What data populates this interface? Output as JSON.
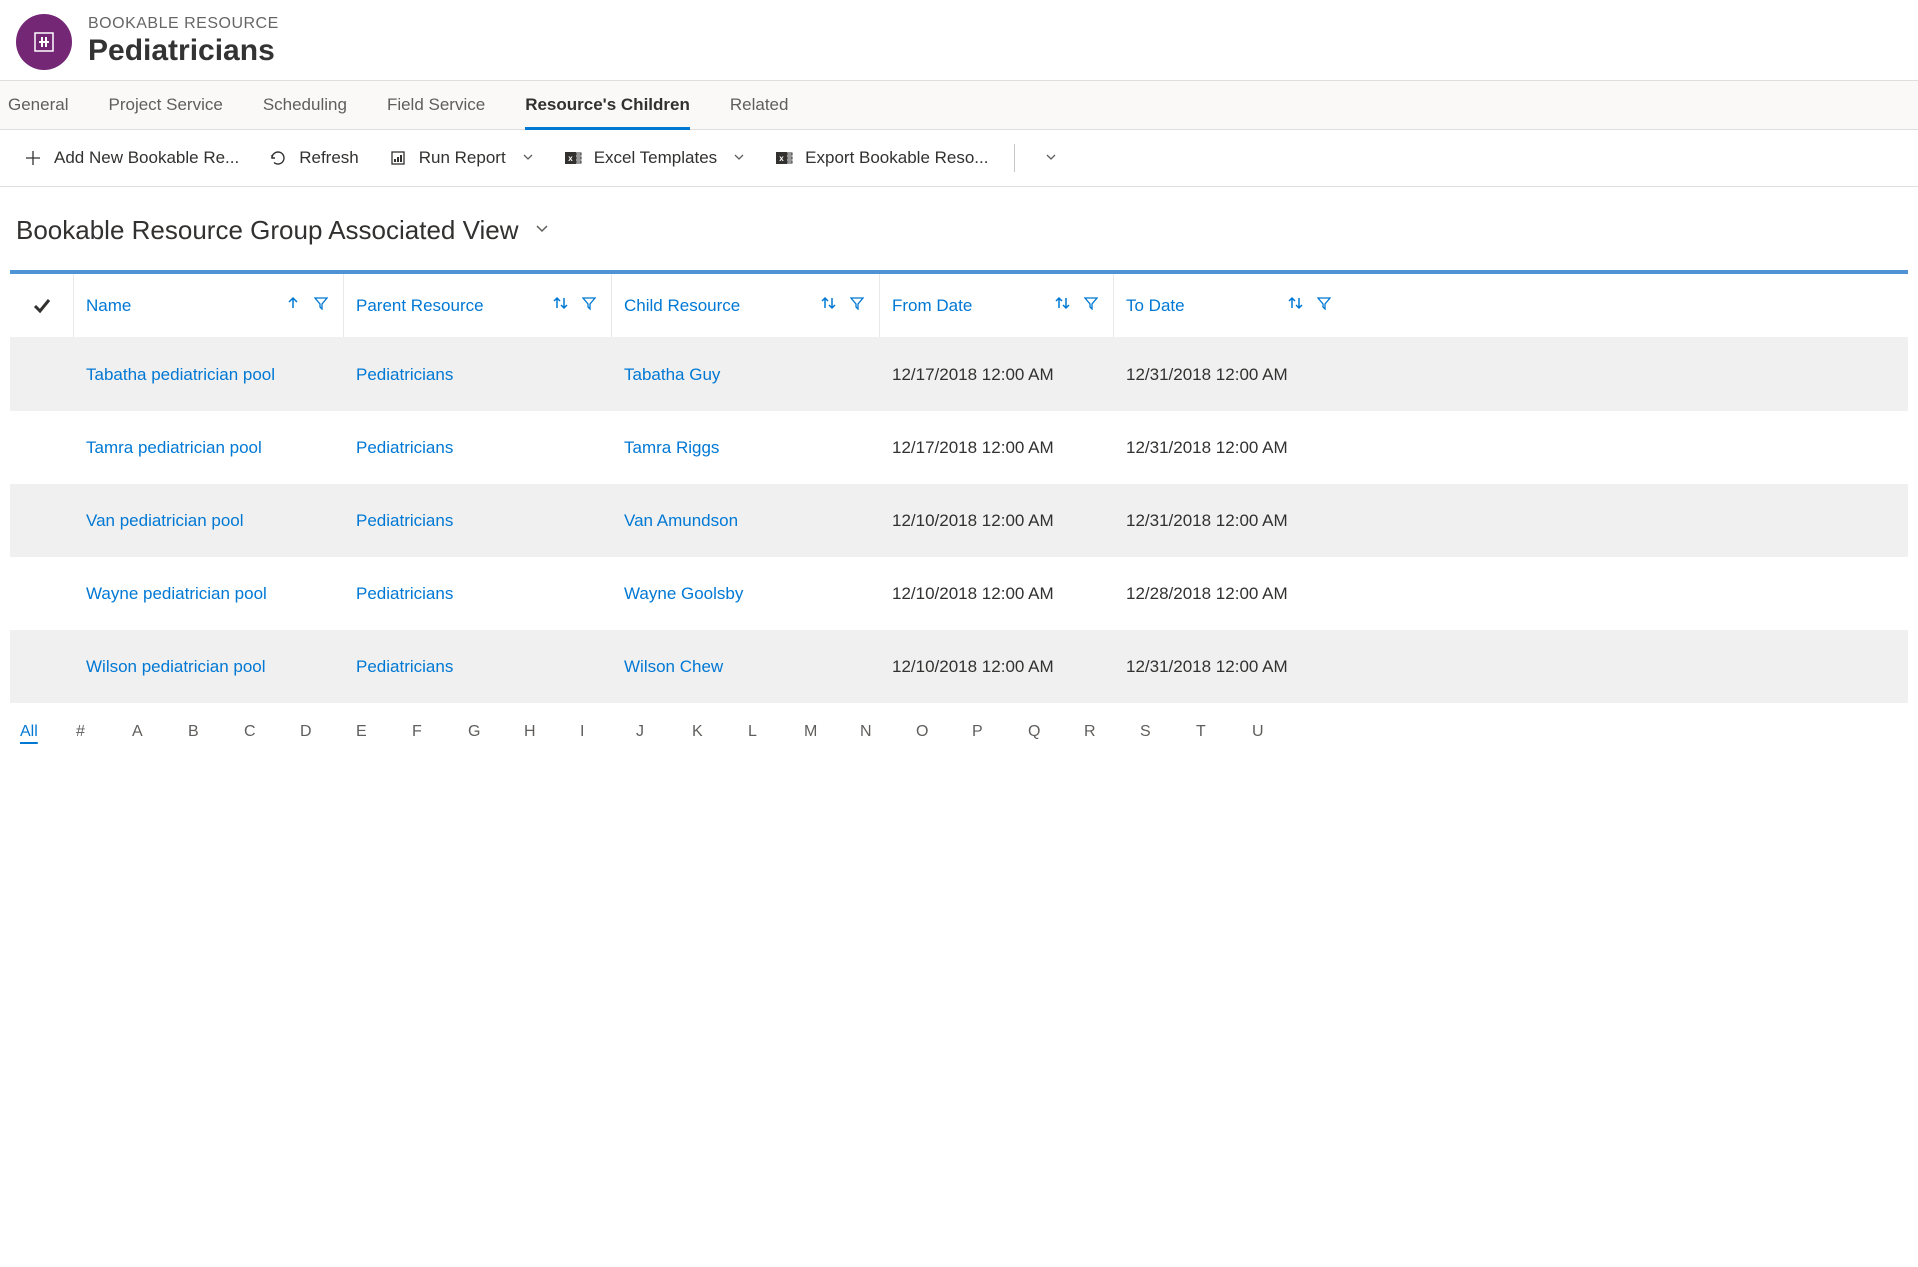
{
  "header": {
    "entity_type": "BOOKABLE RESOURCE",
    "title": "Pediatricians"
  },
  "tabs": [
    {
      "label": "General",
      "active": false
    },
    {
      "label": "Project Service",
      "active": false
    },
    {
      "label": "Scheduling",
      "active": false
    },
    {
      "label": "Field Service",
      "active": false
    },
    {
      "label": "Resource's Children",
      "active": true
    },
    {
      "label": "Related",
      "active": false
    }
  ],
  "toolbar": {
    "add_new": "Add New Bookable Re...",
    "refresh": "Refresh",
    "run_report": "Run Report",
    "excel_templates": "Excel Templates",
    "export": "Export Bookable Reso..."
  },
  "view": {
    "title": "Bookable Resource Group Associated View"
  },
  "columns": {
    "name": "Name",
    "parent": "Parent Resource",
    "child": "Child Resource",
    "from": "From Date",
    "to": "To Date"
  },
  "rows": [
    {
      "name": "Tabatha pediatrician pool",
      "parent": "Pediatricians",
      "child": "Tabatha Guy",
      "from": "12/17/2018 12:00 AM",
      "to": "12/31/2018 12:00 AM"
    },
    {
      "name": "Tamra pediatrician pool",
      "parent": "Pediatricians",
      "child": "Tamra Riggs",
      "from": "12/17/2018 12:00 AM",
      "to": "12/31/2018 12:00 AM"
    },
    {
      "name": "Van pediatrician pool",
      "parent": "Pediatricians",
      "child": "Van Amundson",
      "from": "12/10/2018 12:00 AM",
      "to": "12/31/2018 12:00 AM"
    },
    {
      "name": "Wayne pediatrician pool",
      "parent": "Pediatricians",
      "child": "Wayne Goolsby",
      "from": "12/10/2018 12:00 AM",
      "to": "12/28/2018 12:00 AM"
    },
    {
      "name": "Wilson pediatrician pool",
      "parent": "Pediatricians",
      "child": "Wilson Chew",
      "from": "12/10/2018 12:00 AM",
      "to": "12/31/2018 12:00 AM"
    }
  ],
  "alpha_index": [
    "All",
    "#",
    "A",
    "B",
    "C",
    "D",
    "E",
    "F",
    "G",
    "H",
    "I",
    "J",
    "K",
    "L",
    "M",
    "N",
    "O",
    "P",
    "Q",
    "R",
    "S",
    "T",
    "U"
  ],
  "alpha_active": "All"
}
